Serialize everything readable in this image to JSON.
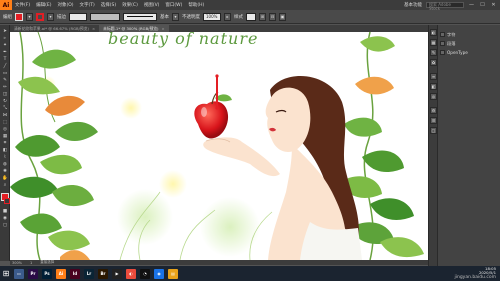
{
  "app": {
    "logo": "Ai"
  },
  "menu": {
    "items": [
      "文件(F)",
      "编辑(E)",
      "对象(O)",
      "文字(T)",
      "选择(S)",
      "效果(C)",
      "视图(V)",
      "窗口(W)",
      "帮助(H)"
    ],
    "workspace": "基本功能",
    "search_placeholder": "搜索 Adobe Stock",
    "win_min": "—",
    "win_max": "☐",
    "win_close": "✕"
  },
  "control": {
    "object_label": "编组",
    "stroke_label": "描边",
    "stroke_style": "基本",
    "opacity_label": "不透明度",
    "opacity_value": "100%",
    "style_label": "样式",
    "fill_color": "#e31e24",
    "stroke_color": "#e31e24"
  },
  "tabs": [
    {
      "label": "清新花纹和苹果.ai* @ 66.67% (RGB/预览)",
      "active": false,
      "close": "×"
    },
    {
      "label": "未标题-1* @ 300% (RGB/预览)",
      "active": true,
      "close": "×"
    }
  ],
  "canvas": {
    "headline": "beauty of nature",
    "accent_color": "#e31e24",
    "leaf_color": "#5d9a3f",
    "hair_color": "#5a2a18",
    "skin_color": "#fbe3cf"
  },
  "status": {
    "zoom": "300%",
    "artboard": "1",
    "mode": "直接选择"
  },
  "panels": {
    "rows": [
      "字符",
      "段落",
      "OpenType"
    ]
  },
  "taskbar": {
    "apps": [
      {
        "name": "Pr",
        "color": "#2a0b46"
      },
      {
        "name": "Ps",
        "color": "#001e36"
      },
      {
        "name": "Ai",
        "color": "#ff7f18"
      },
      {
        "name": "Id",
        "color": "#49021f"
      },
      {
        "name": "Lr",
        "color": "#0a2435"
      },
      {
        "name": "Br",
        "color": "#2b1800"
      }
    ],
    "time": "18:05",
    "date": "2020/5/1",
    "watermark": "jingyan.baidu.com"
  }
}
